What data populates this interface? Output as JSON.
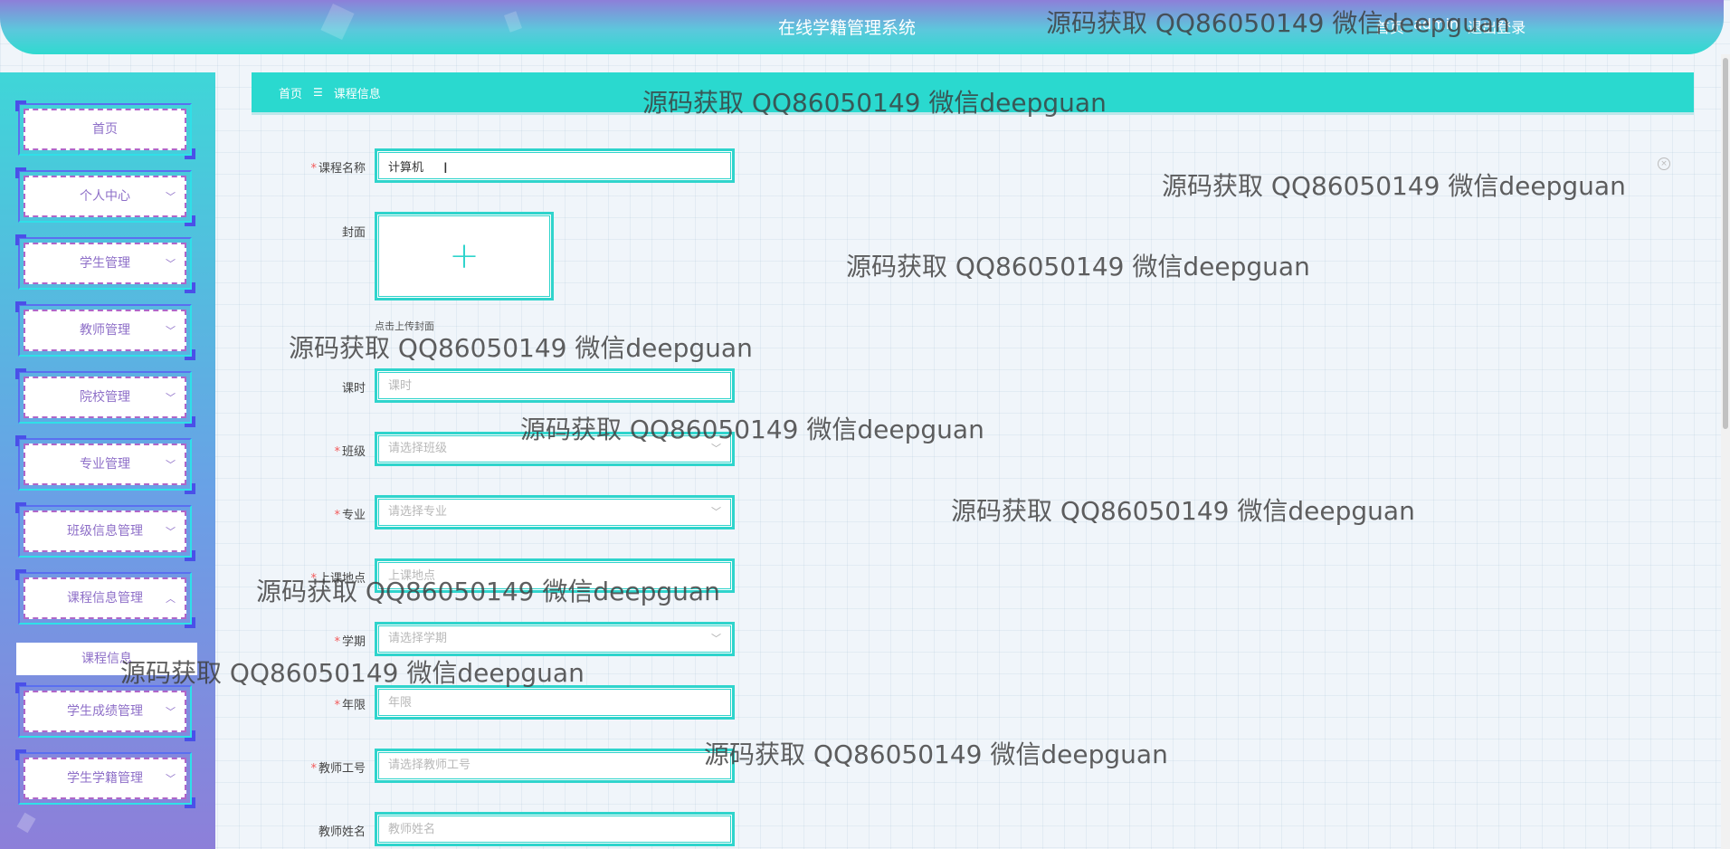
{
  "header": {
    "title": "在线学籍管理系统",
    "links": [
      "首页",
      "admin",
      "退出登录"
    ]
  },
  "watermark": "源码获取 QQ86050149 微信deepguan",
  "sidebar": {
    "items": [
      {
        "label": "首页",
        "has_chevron": false
      },
      {
        "label": "个人中心",
        "has_chevron": true
      },
      {
        "label": "学生管理",
        "has_chevron": true
      },
      {
        "label": "教师管理",
        "has_chevron": true
      },
      {
        "label": "院校管理",
        "has_chevron": true
      },
      {
        "label": "专业管理",
        "has_chevron": true
      },
      {
        "label": "班级信息管理",
        "has_chevron": true
      },
      {
        "label": "课程信息管理",
        "has_chevron": true,
        "expanded": true
      },
      {
        "label": "学生成绩管理",
        "has_chevron": true
      },
      {
        "label": "学生学籍管理",
        "has_chevron": true
      }
    ],
    "submenu": {
      "label": "课程信息"
    }
  },
  "breadcrumb": {
    "home": "首页",
    "separator": "☰",
    "current": "课程信息"
  },
  "form": {
    "course_name": {
      "label": "课程名称",
      "required": true,
      "value": "计算机"
    },
    "cover": {
      "label": "封面",
      "hint": "点击上传封面"
    },
    "hours": {
      "label": "课时",
      "placeholder": "课时"
    },
    "class": {
      "label": "班级",
      "required": true,
      "placeholder": "请选择班级"
    },
    "major": {
      "label": "专业",
      "required": true,
      "placeholder": "请选择专业"
    },
    "location": {
      "label": "上课地点",
      "required": true,
      "placeholder": "上课地点"
    },
    "semester": {
      "label": "学期",
      "required": true,
      "placeholder": "请选择学期"
    },
    "years": {
      "label": "年限",
      "required": true,
      "placeholder": "年限"
    },
    "teacher_id": {
      "label": "教师工号",
      "required": true,
      "placeholder": "请选择教师工号"
    },
    "teacher_name": {
      "label": "教师姓名",
      "placeholder": "教师姓名"
    }
  },
  "icons": {
    "chevron_down": "chevron-down-icon",
    "chevron_up": "chevron-up-icon",
    "plus": "plus-icon",
    "close": "close-circle-icon"
  },
  "colors": {
    "accent": "#2ad9cf",
    "sidebar_text": "#8e6fc8",
    "required": "#f35b5b"
  }
}
